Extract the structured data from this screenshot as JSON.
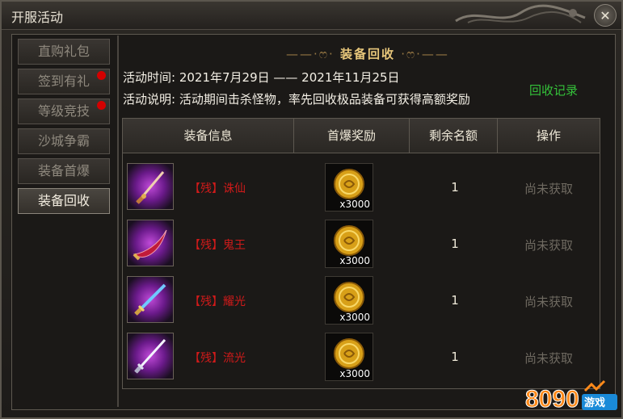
{
  "window": {
    "title": "开服活动",
    "close_symbol": "✕"
  },
  "sidebar": {
    "items": [
      {
        "label": "直购礼包",
        "dot": false,
        "active": false
      },
      {
        "label": "签到有礼",
        "dot": true,
        "active": false
      },
      {
        "label": "等级竞技",
        "dot": true,
        "active": false
      },
      {
        "label": "沙城争霸",
        "dot": false,
        "active": false
      },
      {
        "label": "装备首爆",
        "dot": false,
        "active": false
      },
      {
        "label": "装备回收",
        "dot": false,
        "active": true
      }
    ]
  },
  "main": {
    "title": "装备回收",
    "time_label": "活动时间:",
    "time_value": "2021年7月29日 —— 2021年11月25日",
    "desc_label": "活动说明:",
    "desc_value": "活动期间击杀怪物，率先回收极品装备可获得高额奖励",
    "record_link": "回收记录",
    "table": {
      "headers": [
        "装备信息",
        "首爆奖励",
        "剩余名额",
        "操作"
      ],
      "rows": [
        {
          "name": "【残】诛仙",
          "reward_count": "x3000",
          "remaining": "1",
          "action": "尚未获取"
        },
        {
          "name": "【残】鬼王",
          "reward_count": "x3000",
          "remaining": "1",
          "action": "尚未获取"
        },
        {
          "name": "【残】耀光",
          "reward_count": "x3000",
          "remaining": "1",
          "action": "尚未获取"
        },
        {
          "name": "【残】流光",
          "reward_count": "x3000",
          "remaining": "1",
          "action": "尚未获取"
        }
      ]
    }
  },
  "watermark": {
    "text": "8090游戏"
  },
  "colors": {
    "accent_gold": "#e8c77b",
    "item_name_red": "#d11a1a",
    "record_green": "#34c23a",
    "notification_red": "#d40000"
  }
}
